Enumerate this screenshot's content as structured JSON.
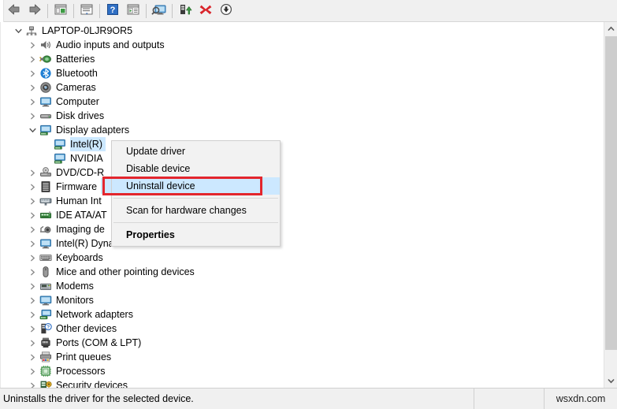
{
  "toolbar": {
    "buttons": [
      {
        "name": "back-button",
        "icon": "left-arrow-icon",
        "label": "Back"
      },
      {
        "name": "forward-button",
        "icon": "right-arrow-icon",
        "label": "Forward"
      },
      {
        "name": "show-hide-console-tree-button",
        "icon": "console-tree-icon",
        "label": "Show/Hide Console Tree"
      },
      {
        "name": "properties-button",
        "icon": "properties-window-icon",
        "label": "Properties"
      },
      {
        "name": "help-button",
        "icon": "question-mark-icon",
        "label": "Help"
      },
      {
        "name": "action-button",
        "icon": "action-window-icon",
        "label": "Action"
      },
      {
        "name": "scan-for-hardware-changes-button",
        "icon": "monitor-scan-icon",
        "label": "Scan for hardware changes"
      },
      {
        "name": "update-driver-button",
        "icon": "update-driver-icon",
        "label": "Update Driver Software"
      },
      {
        "name": "uninstall-device-button",
        "icon": "red-x-icon",
        "label": "Uninstall device"
      },
      {
        "name": "disable-device-button",
        "icon": "down-arrow-circle-icon",
        "label": "Disable device"
      }
    ]
  },
  "tree": {
    "root": {
      "label": "LAPTOP-0LJR9OR5",
      "icon": "computer-node-icon",
      "expanded": true
    },
    "items": [
      {
        "label": "Audio inputs and outputs",
        "icon": "speaker-icon",
        "level": 1,
        "expanded": false
      },
      {
        "label": "Batteries",
        "icon": "battery-icon",
        "level": 1,
        "expanded": false
      },
      {
        "label": "Bluetooth",
        "icon": "bluetooth-icon",
        "level": 1,
        "expanded": false
      },
      {
        "label": "Cameras",
        "icon": "camera-icon",
        "level": 1,
        "expanded": false
      },
      {
        "label": "Computer",
        "icon": "computer-icon",
        "level": 1,
        "expanded": false
      },
      {
        "label": "Disk drives",
        "icon": "disk-drive-icon",
        "level": 1,
        "expanded": false
      },
      {
        "label": "Display adapters",
        "icon": "display-adapter-icon",
        "level": 1,
        "expanded": true
      },
      {
        "label": "Intel(R)",
        "icon": "display-adapter-icon",
        "level": 2,
        "selected": true
      },
      {
        "label": "NVIDIA",
        "icon": "display-adapter-icon",
        "level": 2
      },
      {
        "label": "DVD/CD-R",
        "icon": "dvd-drive-icon",
        "level": 1,
        "expanded": false
      },
      {
        "label": "Firmware",
        "icon": "firmware-icon",
        "level": 1,
        "expanded": false
      },
      {
        "label": "Human Int",
        "icon": "hid-icon",
        "level": 1,
        "expanded": false
      },
      {
        "label": "IDE ATA/AT",
        "icon": "ide-controller-icon",
        "level": 1,
        "expanded": false
      },
      {
        "label": "Imaging de",
        "icon": "imaging-device-icon",
        "level": 1,
        "expanded": false
      },
      {
        "label": "Intel(R) Dynamic Platform and Thermal Framework",
        "icon": "computer-icon",
        "level": 1,
        "expanded": false
      },
      {
        "label": "Keyboards",
        "icon": "keyboard-icon",
        "level": 1,
        "expanded": false
      },
      {
        "label": "Mice and other pointing devices",
        "icon": "mouse-icon",
        "level": 1,
        "expanded": false
      },
      {
        "label": "Modems",
        "icon": "modem-icon",
        "level": 1,
        "expanded": false
      },
      {
        "label": "Monitors",
        "icon": "monitor-icon",
        "level": 1,
        "expanded": false
      },
      {
        "label": "Network adapters",
        "icon": "network-adapter-icon",
        "level": 1,
        "expanded": false
      },
      {
        "label": "Other devices",
        "icon": "unknown-device-icon",
        "level": 1,
        "expanded": false
      },
      {
        "label": "Ports (COM & LPT)",
        "icon": "port-icon",
        "level": 1,
        "expanded": false
      },
      {
        "label": "Print queues",
        "icon": "printer-icon",
        "level": 1,
        "expanded": false
      },
      {
        "label": "Processors",
        "icon": "processor-icon",
        "level": 1,
        "expanded": false
      },
      {
        "label": "Security devices",
        "icon": "security-device-icon",
        "level": 1,
        "expanded": false
      }
    ]
  },
  "context_menu": {
    "items": [
      {
        "label": "Update driver",
        "name": "menu-item-update-driver",
        "highlighted": false,
        "bold": false
      },
      {
        "label": "Disable device",
        "name": "menu-item-disable-device",
        "highlighted": false,
        "bold": false
      },
      {
        "label": "Uninstall device",
        "name": "menu-item-uninstall-device",
        "highlighted": true,
        "bold": false
      },
      {
        "separator": true
      },
      {
        "label": "Scan for hardware changes",
        "name": "menu-item-scan-for-hardware-changes",
        "highlighted": false,
        "bold": false
      },
      {
        "separator": true
      },
      {
        "label": "Properties",
        "name": "menu-item-properties",
        "highlighted": false,
        "bold": true
      }
    ]
  },
  "annotation": {
    "color": "#e3262d",
    "target": "Uninstall device"
  },
  "statusbar": {
    "text": "Uninstalls the driver for the selected device.",
    "watermark": "wsxdn.com"
  },
  "scrollbar": {
    "up_arrow": "chevron-up-icon",
    "down_arrow": "chevron-down-icon"
  },
  "colors": {
    "selection": "#cce8ff",
    "annotation": "#e3262d",
    "chrome": "#f0f0f0"
  }
}
